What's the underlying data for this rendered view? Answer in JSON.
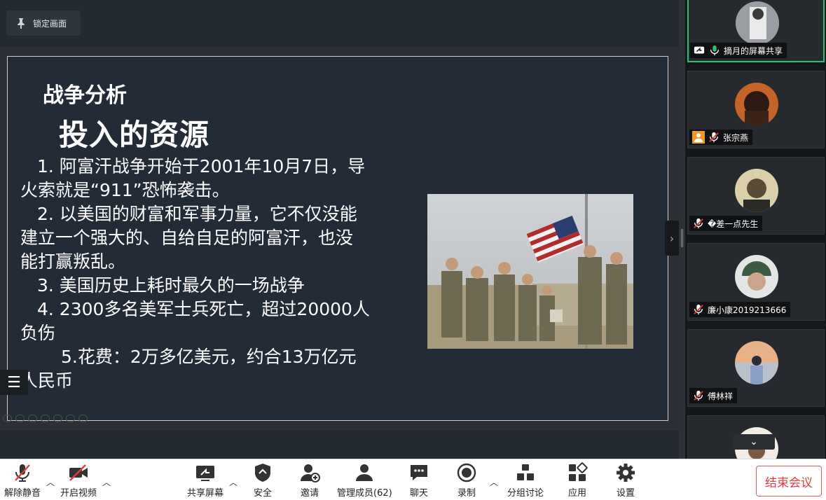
{
  "stage": {
    "lock_label": "锁定画面"
  },
  "slide": {
    "heading": "战争分析",
    "title": "投入的资源",
    "lines": [
      "1. 阿富汗战争开始于2001年10月7日，导",
      "火索就是“911”恐怖袭击。",
      "2. 以美国的财富和军事力量，它不仅没能",
      "建立一个强大的、自给自足的阿富汗，也没",
      "能打赢叛乱。",
      "3. 美国历史上耗时最久的一场战争",
      "4. 2300多名美军士兵死亡，超过20000人",
      "负伤",
      "5.花费：2万多亿美元，约合13万亿元",
      "人民币"
    ],
    "toc_icon": "list-icon"
  },
  "participants": [
    {
      "name": "摘月的屏幕共享",
      "status": "mic-on",
      "sharing": true
    },
    {
      "name": "张宗燕",
      "status": "mic-muted"
    },
    {
      "name": "�差一点先生",
      "status": "mic-muted"
    },
    {
      "name": "廉小康2019213666",
      "status": "mic-muted"
    },
    {
      "name": "傅林祥",
      "status": "mic-muted"
    },
    {
      "name": "",
      "status": ""
    }
  ],
  "toolbar": {
    "unmute": "解除静音",
    "start_video": "开启视频",
    "share_screen": "共享屏幕",
    "security": "安全",
    "invite": "邀请",
    "manage_members": "管理成员(62)",
    "chat": "聊天",
    "record": "录制",
    "breakout": "分组讨论",
    "apps": "应用",
    "settings": "设置",
    "end_meeting": "结束会议"
  },
  "colors": {
    "accent_green": "#2fbf71",
    "end_red": "#e03c3c",
    "mute_red": "#e53935"
  }
}
